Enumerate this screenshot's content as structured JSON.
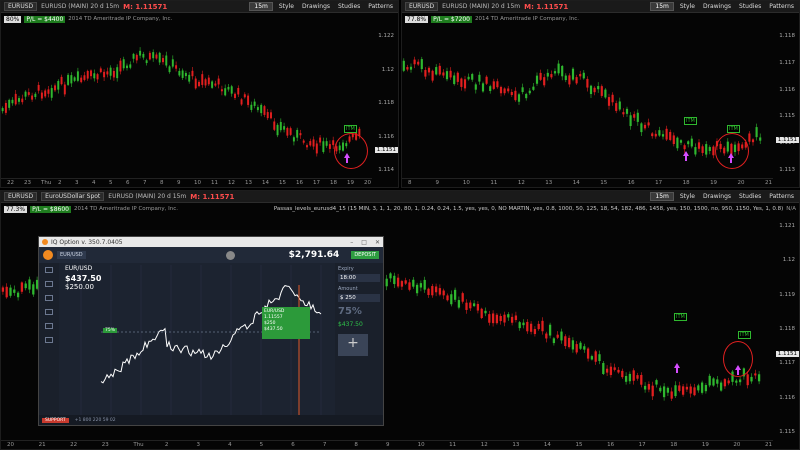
{
  "top_left": {
    "symbol": "EURUSD",
    "interval_text": "EURUSD (MAIN) 20 d 15m",
    "title_red": "M: 1.11571",
    "timeframe": "15m",
    "menu": [
      "Style",
      "Drawings",
      "Studies",
      "Patterns"
    ],
    "info_badge": "80%",
    "pl_text": "P/L = $4400",
    "info_text": "2014 TD Ameritrade IP Company, Inc.",
    "yticks": [
      "1.122",
      "1.12",
      "1.118",
      "1.116",
      "1.114"
    ],
    "price_tag": "1.1151",
    "xticks": [
      "22",
      "23",
      "Thu",
      "2",
      "3",
      "4",
      "5",
      "6",
      "7",
      "8",
      "9",
      "10",
      "11",
      "12",
      "13",
      "14",
      "15",
      "16",
      "17",
      "18",
      "19",
      "20"
    ],
    "labels": [
      "ITM"
    ]
  },
  "top_right": {
    "symbol": "EURUSD",
    "interval_text": "EURUSD (MAIN) 20 d 15m",
    "title_red": "M: 1.11571",
    "timeframe": "15m",
    "menu": [
      "Style",
      "Drawings",
      "Studies",
      "Patterns"
    ],
    "info_badge": "77.8%",
    "pl_text": "P/L = $7200",
    "info_text": "2014 TD Ameritrade IP Company, Inc.",
    "yticks": [
      "1.118",
      "1.117",
      "1.116",
      "1.115",
      "1.114",
      "1.113"
    ],
    "price_tag": "1.1151",
    "xticks": [
      "8",
      "9",
      "10",
      "11",
      "12",
      "13",
      "14",
      "15",
      "16",
      "17",
      "18",
      "19",
      "20",
      "21"
    ],
    "labels": [
      "ITM",
      "ITM"
    ]
  },
  "bottom": {
    "symbol": "EURUSD",
    "study_tab": "EuroUSDollar Spot",
    "interval_text": "EURUSD (MAIN) 20 d 15m",
    "title_red": "M: 1.11571",
    "timeframe": "15m",
    "menu": [
      "Style",
      "Drawings",
      "Studies",
      "Patterns"
    ],
    "info_badge": "77.3%",
    "pl_text": "P/L = $8600",
    "info_text": "2014 TD Ameritrade IP Company, Inc.",
    "study_text": "Passas_levels_eurusd4_15 (15 MIN, 3, 1, 1, 20, 80, 1, 0.24, 0.24, 1.5, yes, yes, 0, NO MARTIN, yes, 0.8, 1000, 50, 125, 18, 54, 182, 486, 1458, yes, 150, 1500, no, 950, 1150, Yes, 1, 0.8)",
    "na_text": "N/A",
    "yticks": [
      "1.121",
      "1.12",
      "1.119",
      "1.118",
      "1.117",
      "1.116",
      "1.115"
    ],
    "price_tag": "1.1151",
    "xticks": [
      "20",
      "21",
      "22",
      "23",
      "Thu",
      "2",
      "3",
      "4",
      "5",
      "6",
      "7",
      "8",
      "9",
      "10",
      "11",
      "12",
      "13",
      "14",
      "15",
      "16",
      "17",
      "18",
      "19",
      "20",
      "21"
    ],
    "labels": [
      "ITM",
      "ITM"
    ]
  },
  "iq_window": {
    "title": "IQ Option v. 350.7.0405",
    "asset_tab": "EUR/USD",
    "asset": "EUR/USD",
    "amount": "$437.50",
    "balance_line": "$250.00",
    "balance": "$2,791.64",
    "deposit_button": "DEPOSIT",
    "popup_lines": [
      "EUR/USD",
      "1.11557",
      "$250",
      "$437.50"
    ],
    "right_fields": [
      {
        "label": "Expiry",
        "value": "18:00"
      },
      {
        "label": "Amount",
        "value": "$ 250"
      }
    ],
    "pct": "75%",
    "profit_label": "$437.50",
    "tag_75": "75%",
    "tag_green": "1.11557",
    "bottom_btn": "SUPPORT",
    "bottom_text": "+1 800 220 59 02"
  },
  "colors": {
    "up": "#2fb82f",
    "down": "#e21f1f",
    "circle": "#e02020",
    "arrow": "#d64dff"
  }
}
